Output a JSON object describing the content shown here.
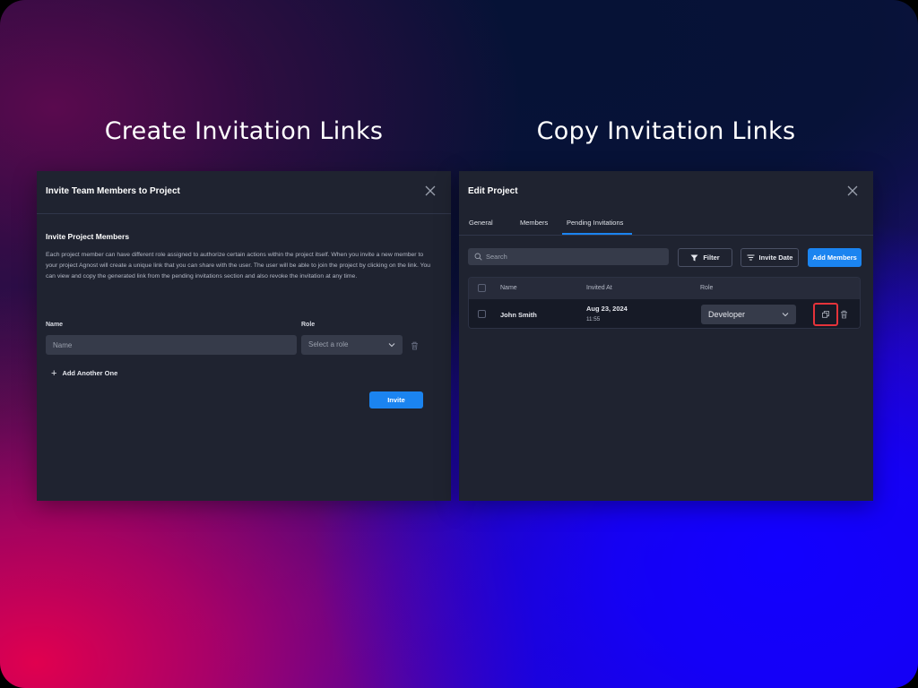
{
  "headings": {
    "left": "Create Invitation Links",
    "right": "Copy Invitation Links"
  },
  "invite_panel": {
    "title": "Invite Team Members to Project",
    "section_title": "Invite Project Members",
    "description": "Each project member can have different role assigned to authorize certain actions within the project itself. When you invite a new member to your project Agnost will create a unique link that you can share with the user. The user will be able to join the project by clicking on the link. You can view and copy the generated link from the pending invitations section and also revoke the invitation at any time.",
    "name_label": "Name",
    "name_placeholder": "Name",
    "role_label": "Role",
    "role_placeholder": "Select a role",
    "add_another_label": "Add Another One",
    "invite_button": "Invite"
  },
  "edit_panel": {
    "title": "Edit Project",
    "tabs": [
      {
        "label": "General"
      },
      {
        "label": "Members"
      },
      {
        "label": "Pending Invitations"
      }
    ],
    "active_tab": "Pending Invitations",
    "search_placeholder": "Search",
    "filter_button": "Filter",
    "sort_button": "Invite Date",
    "add_members_button": "Add Members",
    "table": {
      "columns": [
        "Name",
        "Invited At",
        "Role"
      ],
      "rows": [
        {
          "name": "John Smith",
          "invited_date": "Aug 23, 2024",
          "invited_time": "11:55",
          "role": "Developer"
        }
      ]
    }
  },
  "colors": {
    "accent": "#1b84f0",
    "highlight": "#e5333a",
    "panel_bg": "#1f2330"
  }
}
